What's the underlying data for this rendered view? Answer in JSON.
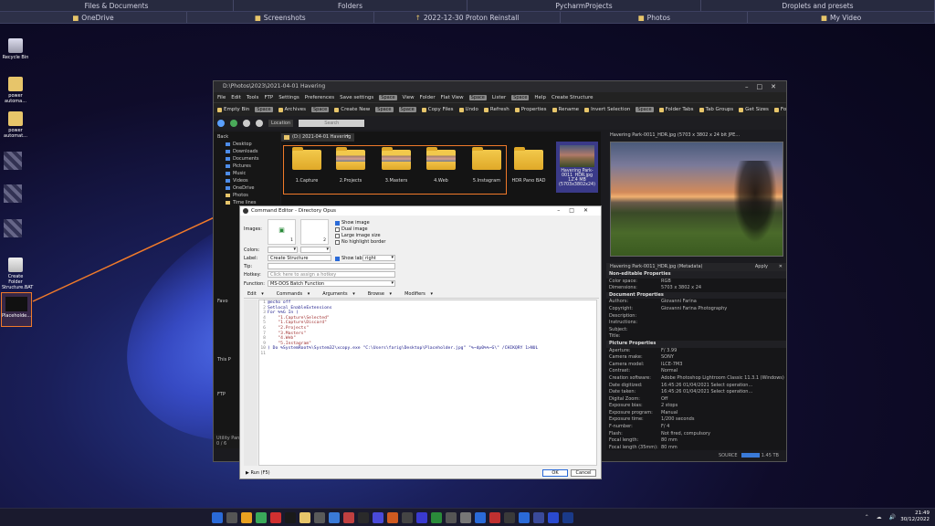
{
  "topbar": {
    "row1": [
      "Files & Documents",
      "Folders",
      "PycharmProjects",
      "Droplets and presets"
    ],
    "row2": [
      "OneDrive",
      "Screenshots",
      "2022-12-30 Proton Reinstall",
      "Photos",
      "My Video"
    ]
  },
  "desktop": {
    "recycle_bin": "Recycle Bin",
    "icon1": "power automa...",
    "icon2": "power automat...",
    "create_folder": "Create Folder Structure.BAT",
    "placeholder": "Placeholde..."
  },
  "window": {
    "title": "D:\\Photos\\2023\\2021-04-01 Havering",
    "menu": [
      "File",
      "Edit",
      "Tools",
      "FTP",
      "Settings",
      "Preferences",
      "Save settings",
      "Space",
      "View",
      "Folder",
      "Flat View",
      "Space",
      "Lister",
      "Space",
      "Help",
      "Create Structure"
    ],
    "toolbar1": [
      "Empty Bin",
      "Space",
      "Archives",
      "Space",
      "Create New",
      "Space",
      "Space",
      "Copy Files",
      "Undo",
      "Refresh",
      "Properties",
      "Rename",
      "Invert Selection",
      "Space",
      "Folder Tabs",
      "Tab Groups",
      "Get Sizes",
      "Format Lock"
    ],
    "toolbar2": {
      "location_label": "Location",
      "search_placeholder": "Search"
    },
    "tree_back": "Back",
    "tree_items": [
      "Desktop",
      "Downloads",
      "Documents",
      "Pictures",
      "Music",
      "Videos",
      "OneDrive",
      "Photos",
      "Time lines"
    ],
    "tree_lower": [
      "Favo",
      "This P",
      "FTP"
    ],
    "tree_footer": "Utility Panel",
    "tree_footer2": "0 / 6",
    "tab_label": "(D:) 2021-04-01 Havering",
    "folders": [
      "1.Capture",
      "2.Projects",
      "3.Masters",
      "4.Web",
      "5.Instagram",
      "HDR Pano BAD"
    ],
    "selected_file": {
      "name": "Havering Park-0011_HDR.jpg",
      "info": "12.4 MB (5703x3802x24)"
    },
    "preview_header": "Havering Park-0011_HDR.jpg (5703 x 3802 x 24 bit JPE...",
    "metadata_header": "Havering Park-0011_HDR.jpg (Metadata)",
    "metadata_apply": "Apply",
    "metadata_cancel": "Close",
    "metadata": [
      {
        "section": "Non-editable Properties"
      },
      {
        "k": "Color space:",
        "v": "RGB"
      },
      {
        "k": "Dimensions:",
        "v": "5703 x 3802 x 24"
      },
      {
        "section": "Document Properties"
      },
      {
        "k": "Authors:",
        "v": "Giovanni Farina"
      },
      {
        "k": "Copyright:",
        "v": "Giovanni Farina Photography"
      },
      {
        "k": "Description:",
        "v": ""
      },
      {
        "k": "Instructions:",
        "v": ""
      },
      {
        "k": "Subject:",
        "v": ""
      },
      {
        "k": "Title:",
        "v": ""
      },
      {
        "section": "Picture Properties"
      },
      {
        "k": "Aperture:",
        "v": "F/  3.99"
      },
      {
        "k": "Camera make:",
        "v": "SONY"
      },
      {
        "k": "Camera model:",
        "v": "ILCE-7M3"
      },
      {
        "k": "Contrast:",
        "v": "Normal"
      },
      {
        "k": "Creation software:",
        "v": "Adobe Photoshop Lightroom Classic 11.3.1 (Windows)"
      },
      {
        "k": "Date digitized:",
        "v": "16:45:26          01/04/2021        Select operation..."
      },
      {
        "k": "Date taken:",
        "v": "16:45:26          01/04/2021        Select operation..."
      },
      {
        "k": "Digital Zoom:",
        "v": "Off"
      },
      {
        "k": "Exposure bias:",
        "v": "2      stops"
      },
      {
        "k": "Exposure program:",
        "v": "Manual"
      },
      {
        "k": "Exposure time:",
        "v": "1/200      seconds"
      },
      {
        "k": "F-number:",
        "v": "F/  4"
      },
      {
        "k": "Flash:",
        "v": "Not fired, compulsory"
      },
      {
        "k": "Focal length:",
        "v": "80      mm"
      },
      {
        "k": "Focal length (35mm):",
        "v": "80      mm"
      }
    ],
    "status_source": "SOURCE",
    "status_size": "1.45 TB"
  },
  "dialog": {
    "title": "Command Editor - Directory Opus",
    "images_label": "Images:",
    "img1_num": "1",
    "img2_num": "2",
    "show_image": "Show image",
    "dual_image": "Dual image",
    "large_image": "Large image size",
    "no_highlight": "No highlight border",
    "colors_label": "Colors:",
    "label_label": "Label:",
    "label_value": "Create Structure",
    "show_label": "Show label",
    "show_label_pos": "right",
    "tip_label": "Tip:",
    "hotkey_label": "Hotkey:",
    "hotkey_placeholder": "Click here to assign a hotkey",
    "function_label": "Function:",
    "function_value": "MS-DOS Batch Function",
    "toolbar": [
      "Edit",
      "Commands",
      "Arguments",
      "Browse",
      "Modifiers"
    ],
    "code": [
      {
        "n": "1",
        "t": "@echo off",
        "s": false
      },
      {
        "n": "2",
        "t": "Setlocal EnableExtensions",
        "s": false
      },
      {
        "n": "3",
        "t": "For %%G In (",
        "s": false
      },
      {
        "n": "4",
        "t": "    \"1.Capture\\Selected\"",
        "s": true
      },
      {
        "n": "5",
        "t": "    \"1.Capture\\Discard\"",
        "s": true
      },
      {
        "n": "6",
        "t": "    \"2.Projects\"",
        "s": true
      },
      {
        "n": "7",
        "t": "    \"3.Masters\"",
        "s": true
      },
      {
        "n": "8",
        "t": "    \"4.Web\"",
        "s": true
      },
      {
        "n": "9",
        "t": "    \"5.Instagram\"",
        "s": true
      },
      {
        "n": "10",
        "t": ") Do %SystemRoot%\\System32\\xcopy.exe \"C:\\Users\\farig\\Desktop\\Placeholder.jpg\" \"%~dp0%%~G\\\" /CHIKQRY 1>NUL",
        "s": false
      },
      {
        "n": "11",
        "t": "",
        "s": false
      }
    ],
    "run": "Run (F5)",
    "ok": "OK",
    "cancel": "Cancel"
  },
  "taskbar": {
    "time": "21:49",
    "date": "30/12/2022"
  }
}
